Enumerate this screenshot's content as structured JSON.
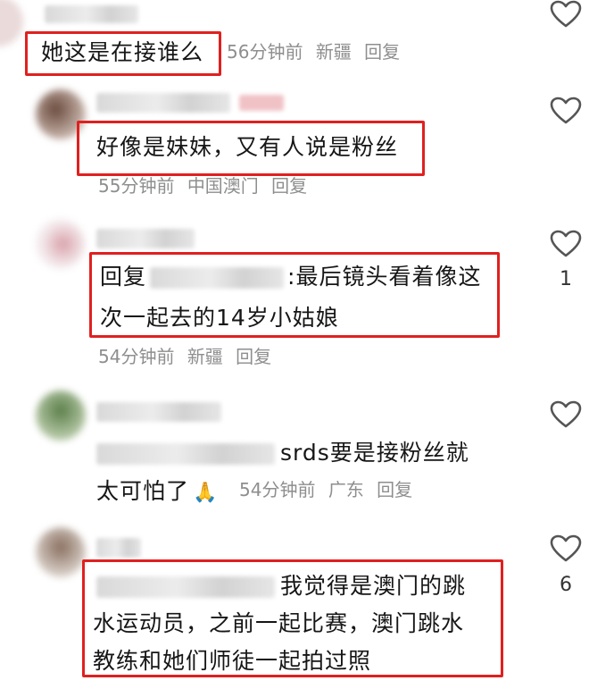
{
  "comments": [
    {
      "text": "她这是在接谁么",
      "time": "56分钟前",
      "location": "新疆",
      "reply": "回复",
      "likes": ""
    },
    {
      "text": "好像是妹妹，又有人说是粉丝",
      "time": "55分钟前",
      "location": "中国澳门",
      "reply": "回复",
      "likes": ""
    },
    {
      "reply_prefix": "回复",
      "line1_after": ":最后镜头看着像这",
      "line2": "次一起去的14岁小姑娘",
      "time": "54分钟前",
      "location": "新疆",
      "reply": "回复",
      "likes": "1"
    },
    {
      "line1_after": "srds要是接粉丝就",
      "line2": "太可怕了",
      "emoji": "🙏",
      "time": "54分钟前",
      "location": "广东",
      "reply": "回复",
      "likes": ""
    },
    {
      "line1_after": "我觉得是澳门的跳",
      "line2": "水运动员，之前一起比赛，澳门跳水",
      "line3": "教练和她们师徒一起拍过照",
      "likes": "6"
    }
  ],
  "colors": {
    "highlight_border": "#e02020",
    "meta_text": "#8e8e8e",
    "icon_stroke": "#555555"
  },
  "icons": [
    "heart-icon",
    "avatar"
  ]
}
